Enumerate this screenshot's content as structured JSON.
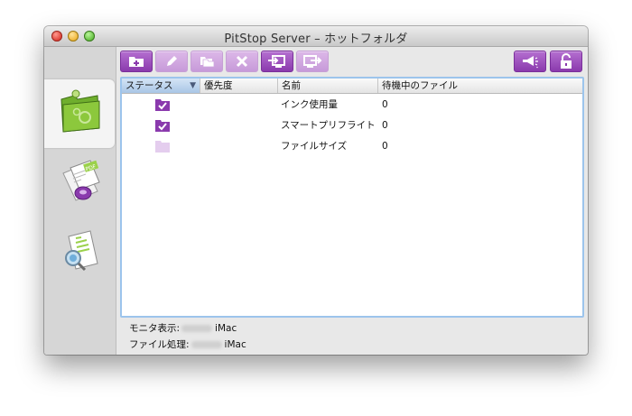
{
  "window": {
    "title": "PitStop Server – ホットフォルダ"
  },
  "toolbar": {
    "buttons": [
      {
        "id": "new-hotfolder",
        "icon": "folder-plus-icon",
        "enabled": true
      },
      {
        "id": "edit",
        "icon": "pencil-icon",
        "enabled": false
      },
      {
        "id": "duplicate",
        "icon": "folders-icon",
        "enabled": false
      },
      {
        "id": "delete",
        "icon": "x-icon",
        "enabled": false
      },
      {
        "id": "import",
        "icon": "import-icon",
        "enabled": true
      },
      {
        "id": "export",
        "icon": "export-icon",
        "enabled": false
      },
      {
        "id": "announce",
        "icon": "megaphone-icon",
        "enabled": true
      },
      {
        "id": "lock",
        "icon": "unlock-icon",
        "enabled": true
      }
    ]
  },
  "sidebar": {
    "items": [
      {
        "id": "hotfolders",
        "icon": "green-folder-icon",
        "active": true
      },
      {
        "id": "pdf-profiles",
        "icon": "pdf-document-icon",
        "active": false
      },
      {
        "id": "reports",
        "icon": "magnifier-checklist-icon",
        "active": false
      }
    ]
  },
  "table": {
    "columns": [
      "ステータス",
      "優先度",
      "名前",
      "待機中のファイル"
    ],
    "sort_arrow": "▼",
    "rows": [
      {
        "status": "checked",
        "priority": "",
        "name": "インク使用量",
        "waiting": "0"
      },
      {
        "status": "checked",
        "priority": "",
        "name": "スマートプリフライト",
        "waiting": "0"
      },
      {
        "status": "empty",
        "priority": "",
        "name": "ファイルサイズ",
        "waiting": "0"
      }
    ]
  },
  "footer": {
    "monitor_label": "モニタ表示:",
    "monitor_value": "iMac",
    "processing_label": "ファイル処理:",
    "processing_value": "iMac"
  },
  "colors": {
    "accent_purple": "#8a3aad",
    "disabled_purple": "#d3acdf",
    "selection_blue": "#9cc4ec"
  }
}
